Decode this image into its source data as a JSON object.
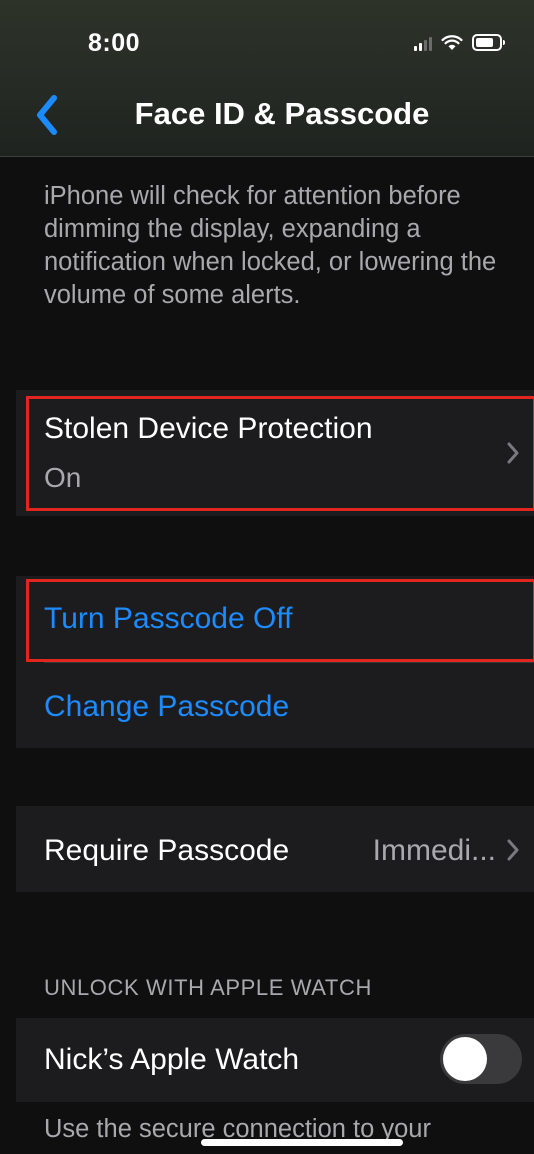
{
  "status_bar": {
    "time": "8:00"
  },
  "nav": {
    "title": "Face ID & Passcode",
    "back_icon": "chevron-left-icon"
  },
  "attention_description": "iPhone will check for attention before dimming the display, expanding a notification when locked, or lowering the volume of some alerts.",
  "stolen_device": {
    "title": "Stolen Device Protection",
    "value": "On"
  },
  "passcode_actions": {
    "turn_off": "Turn Passcode Off",
    "change": "Change Passcode"
  },
  "require_passcode": {
    "label": "Require Passcode",
    "value": "Immedi..."
  },
  "apple_watch": {
    "section_header": "UNLOCK WITH APPLE WATCH",
    "device_name": "Nick’s Apple Watch",
    "toggle_on": false,
    "footer_partial": "Use the secure connection to your"
  },
  "colors": {
    "accent": "#1b8bff",
    "highlight": "#e0261e",
    "cell": "#1c1c1e",
    "background": "#0f0f10"
  }
}
